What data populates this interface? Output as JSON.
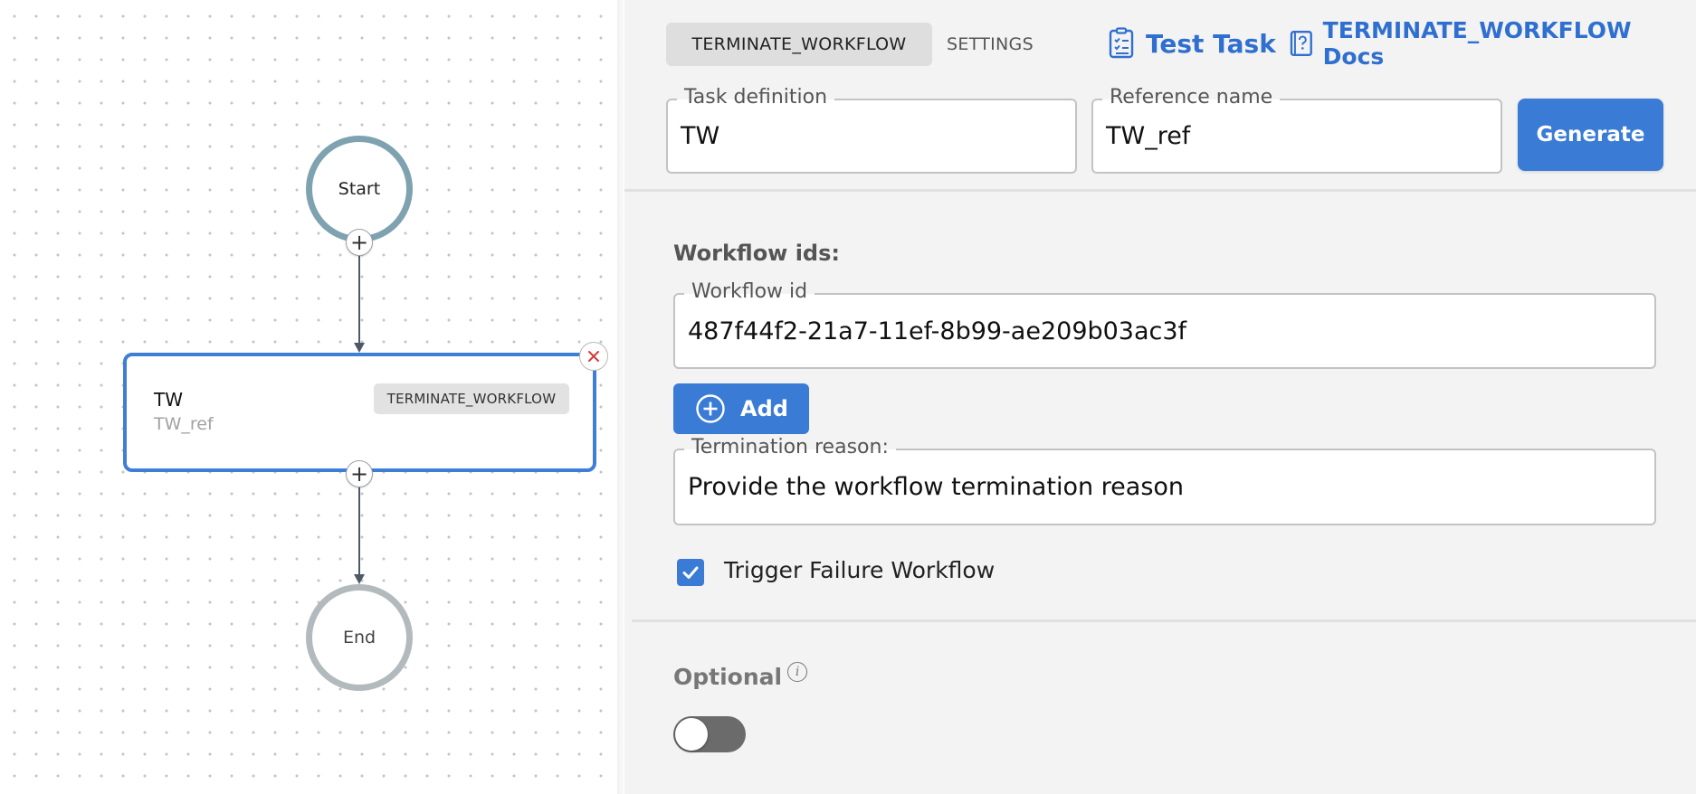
{
  "canvas": {
    "start_node": {
      "label": "Start"
    },
    "end_node": {
      "label": "End"
    },
    "task_node": {
      "name": "TW",
      "ref": "TW_ref",
      "type": "TERMINATE_WORKFLOW"
    }
  },
  "panel": {
    "tabs": [
      {
        "label": "TERMINATE_WORKFLOW",
        "active": true
      },
      {
        "label": "SETTINGS",
        "active": false
      }
    ],
    "links": {
      "test_task": "Test Task",
      "docs": "TERMINATE_WORKFLOW Docs"
    },
    "task_definition": {
      "label": "Task definition",
      "value": "TW"
    },
    "reference_name": {
      "label": "Reference name",
      "value": "TW_ref"
    },
    "generate_label": "Generate",
    "workflow_ids": {
      "heading": "Workflow ids:",
      "field_label": "Workflow id",
      "value": "487f44f2-21a7-11ef-8b99-ae209b03ac3f",
      "add_label": "Add"
    },
    "termination_reason": {
      "label": "Termination reason:",
      "value": "Provide the workflow termination reason"
    },
    "trigger_failure": {
      "label": "Trigger Failure Workflow",
      "checked": true
    },
    "optional": {
      "label": "Optional",
      "enabled": false
    },
    "colors": {
      "accent": "#3a7bd5",
      "link": "#2f6fcf",
      "panel_bg": "#f3f3f3"
    },
    "icons": [
      "checklist-icon",
      "docs-book-icon",
      "plus-circle-icon",
      "checkmark-icon",
      "info-icon",
      "close-icon"
    ]
  }
}
